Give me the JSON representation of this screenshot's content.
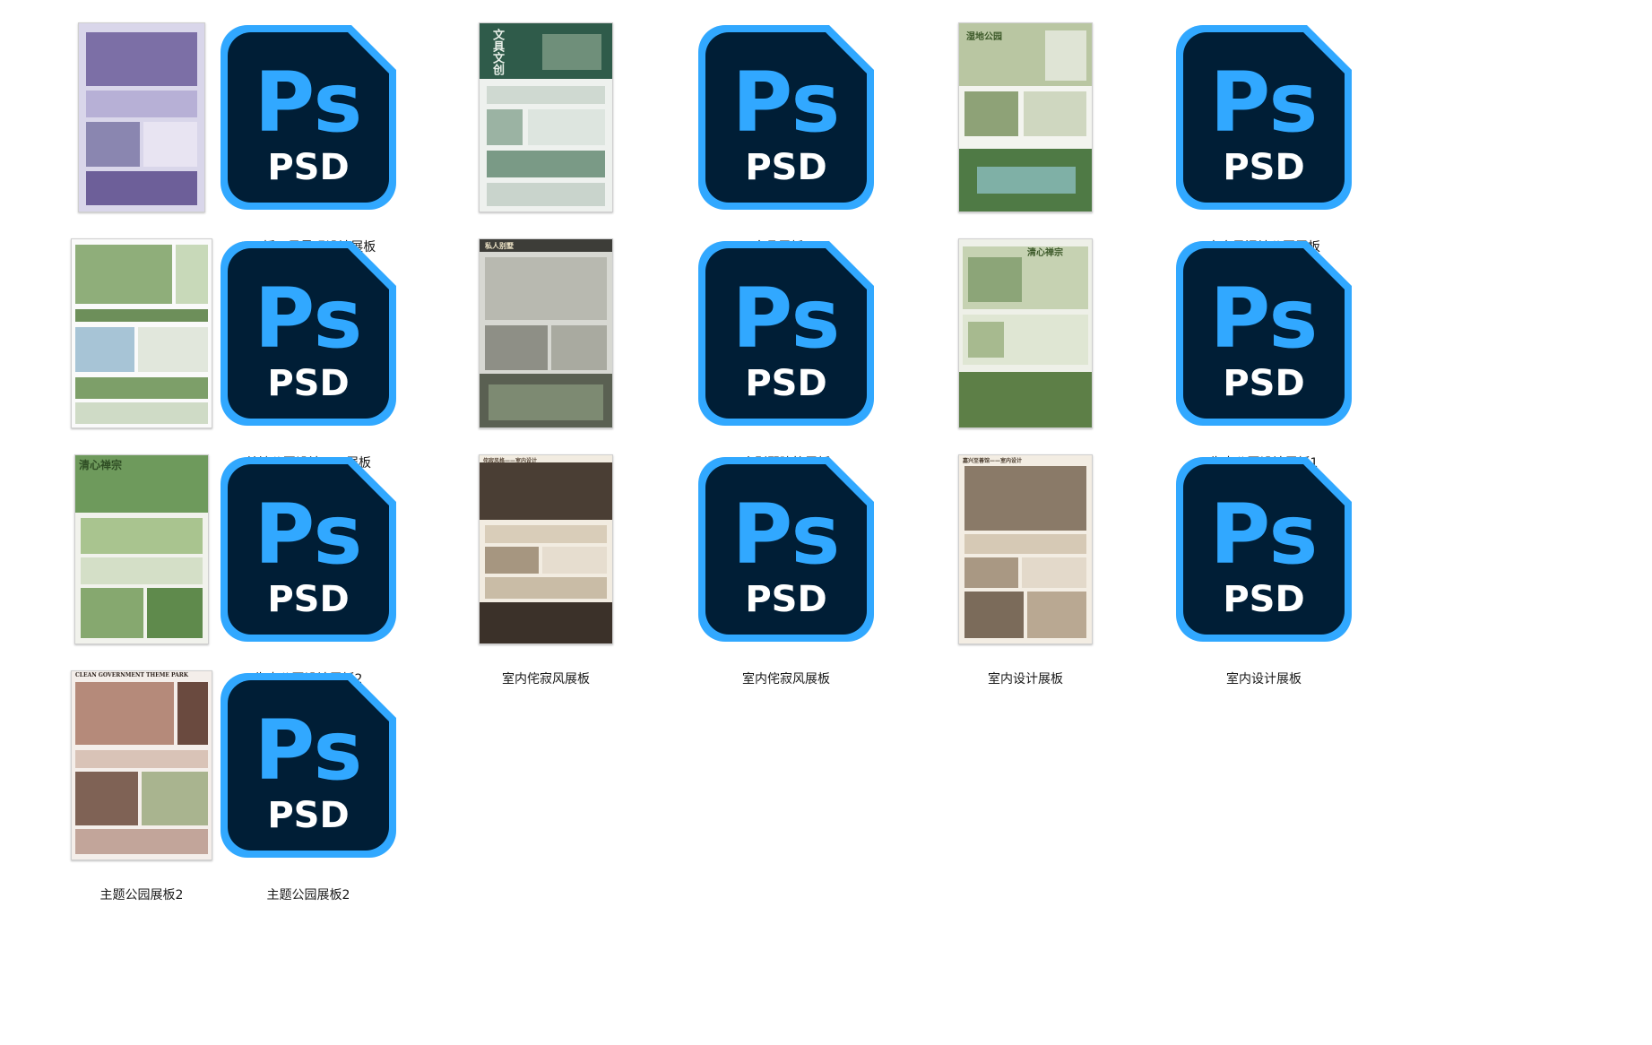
{
  "window": {
    "view": "large-icons"
  },
  "colors": {
    "ps_bg": "#001e36",
    "ps_accent": "#31a8ff",
    "label_text": "#1a1a1a"
  },
  "files": [
    {
      "name": "N1-插画风景观设计展板",
      "kind": "thumbnail",
      "theme": "purple"
    },
    {
      "name": "N1-插画风景观设计展板",
      "kind": "psd-icon"
    },
    {
      "name": "产品展板01",
      "kind": "thumbnail",
      "theme": "product"
    },
    {
      "name": "产品展板01",
      "kind": "psd-icon"
    },
    {
      "name": "竞赛风湿地公园展板",
      "kind": "thumbnail",
      "theme": "wetland"
    },
    {
      "name": "竞赛风湿地公园展板",
      "kind": "psd-icon"
    },
    {
      "name": "某地公园设计PSD展板",
      "kind": "thumbnail",
      "theme": "park"
    },
    {
      "name": "某地公园设计PSD展板",
      "kind": "psd-icon"
    },
    {
      "name": "人别墅建筑展板",
      "kind": "thumbnail",
      "theme": "villa"
    },
    {
      "name": "人别墅建筑展板",
      "kind": "psd-icon"
    },
    {
      "name": "生态公园设计展板1",
      "kind": "thumbnail",
      "theme": "eco1"
    },
    {
      "name": "生态公园设计展板1",
      "kind": "psd-icon"
    },
    {
      "name": "生态公园设计展板2",
      "kind": "thumbnail",
      "theme": "eco2"
    },
    {
      "name": "生态公园设计展板2",
      "kind": "psd-icon"
    },
    {
      "name": "室内侘寂风展板",
      "kind": "thumbnail",
      "theme": "wabi"
    },
    {
      "name": "室内侘寂风展板",
      "kind": "psd-icon"
    },
    {
      "name": "室内设计展板",
      "kind": "thumbnail",
      "theme": "interior"
    },
    {
      "name": "室内设计展板",
      "kind": "psd-icon"
    },
    {
      "name": "主题公园展板2",
      "kind": "thumbnail",
      "theme": "theme"
    },
    {
      "name": "主题公园展板2",
      "kind": "psd-icon"
    }
  ],
  "psd_icon": {
    "logo": "Ps",
    "ext": "PSD",
    "icon": "photoshop-file-icon"
  },
  "poster_texts": {
    "product": "文具文创",
    "wetland": "湿地公园",
    "villa": "私人别墅",
    "eco1": "清心禅宗",
    "eco2": "清心禅宗",
    "wabi": "侘寂风格——室内设计",
    "interior": "嘉兴至善馆——室内设计",
    "theme": "CLEAN GOVERNMENT THEME PARK"
  }
}
